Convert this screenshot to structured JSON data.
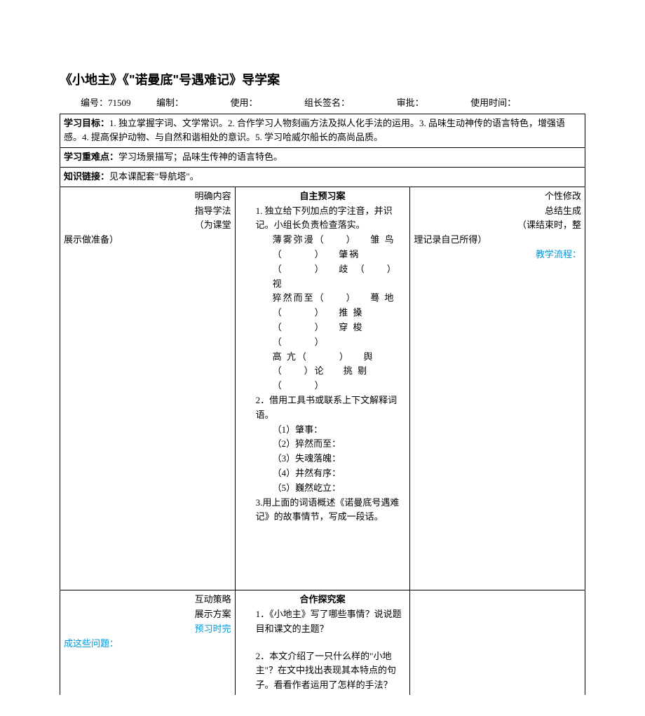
{
  "title": "《小地主》《\"诺曼底\"号遇难记》导学案",
  "header": {
    "number_label": "编号：",
    "number_value": "71509",
    "author_label": "编制：",
    "use_label": "使用：",
    "leader_label": "组长签名：",
    "approve_label": "审批：",
    "time_label": "使用时间："
  },
  "goals": {
    "label": "学习目标：",
    "text": "1. 独立掌握字词、文学常识。2. 合作学习人物刻画方法及拟人化手法的运用。3. 品味生动神传的语言特色，增强语感。4. 提高保护动物、与自然和谐相处的意识。5. 学习哈威尔船长的高尚品质。"
  },
  "focus": {
    "label": "学习重难点：",
    "text": "学习场景描写；品味生传神的语言特色。"
  },
  "knowledge": {
    "label": "知识链接：",
    "text": "见本课配套\"导航塔\"。"
  },
  "section1": {
    "left1": "明确内容",
    "left2": "指导学法",
    "left3": "（为课堂",
    "left4": "展示做准备）",
    "center_title": "自主预习案",
    "c1": "1. 独立给下列加点的字注音，并识记。小组长负责检查落实。",
    "c2a": "薄雾弥漫（　　）",
    "c2b": "雏 鸟（　　　）",
    "c2c": "肇祸（　　　）",
    "c2d": "歧　（　　）视",
    "c3a": "猝然而至（　　）",
    "c3b": "蓦 地（　　　）",
    "c3c": "推 搡（　　　）",
    "c3d": "穿 梭（　　　）",
    "c4a": "高 亢（　　　）",
    "c4b": "舆　（　　）论",
    "c4c": "挑 剔（　　　）",
    "c5": "2．借用工具书或联系上下文解释词语。",
    "c6": "（1）肇事：",
    "c7": "（2）猝然而至：",
    "c8": "（3）失魂落魄：",
    "c9": "（4）井然有序：",
    "c10": "（5）巍然屹立：",
    "c11": "3.用上面的词语概述《诺曼底号遇难记》的故事情节，写成一段话。",
    "right1": "个性修改",
    "right2": "总结生成",
    "right3": "（课结束时，整",
    "right4": "理记录自己所得）",
    "right5": "教学流程："
  },
  "section2": {
    "left1": "互动策略",
    "left2": "展示方案",
    "left3": "预习时完",
    "left4": "成这些问题：",
    "center_title": "合作探究案",
    "q1": "1．《小地主》写了哪些事情？说说题目和课文的主题？",
    "q2": "2．本文介绍了一只什么样的\"小地主\"？在文中找出表现其本特点的句子。看看作者运用了怎样的手法？"
  }
}
